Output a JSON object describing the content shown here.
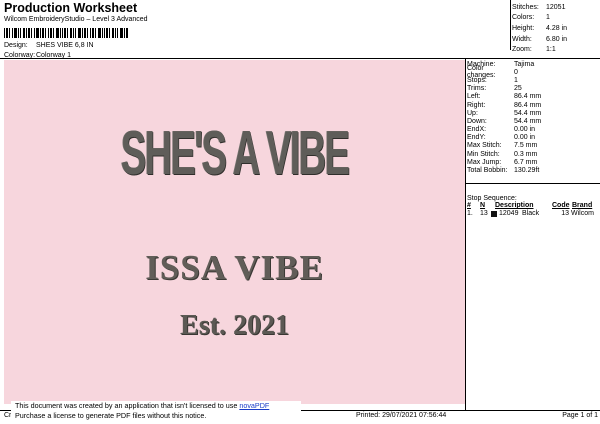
{
  "header": {
    "title": "Production Worksheet",
    "subtitle": "Wilcom EmbroideryStudio – Level 3 Advanced",
    "design_label": "Design:",
    "design_value": "SHES VIBE 6,8 IN",
    "colorway_label": "Colorway:",
    "colorway_value": "Colorway 1"
  },
  "stats": [
    {
      "label": "Stitches:",
      "value": "12051"
    },
    {
      "label": "Colors:",
      "value": "1"
    },
    {
      "label": "Height:",
      "value": "4.28 in"
    },
    {
      "label": "Width:",
      "value": "6.80 in"
    },
    {
      "label": "Zoom:",
      "value": "1:1"
    }
  ],
  "design_text": {
    "line1": "SHE'S A VIBE",
    "line2": "ISSA VIBE",
    "line3": "Est. 2021"
  },
  "machine_info": [
    {
      "label": "Machine:",
      "value": "Tajima"
    },
    {
      "label": "Color changes:",
      "value": "0"
    },
    {
      "label": "Stops:",
      "value": "1"
    },
    {
      "label": "Trims:",
      "value": "25"
    },
    {
      "label": "Left:",
      "value": "86.4 mm"
    },
    {
      "label": "Right:",
      "value": "86.4 mm"
    },
    {
      "label": "Up:",
      "value": "54.4 mm"
    },
    {
      "label": "Down:",
      "value": "54.4 mm"
    },
    {
      "label": "EndX:",
      "value": "0.00 in"
    },
    {
      "label": "EndY:",
      "value": "0.00 in"
    },
    {
      "label": "Max Stitch:",
      "value": "7.5 mm"
    },
    {
      "label": "Min Stitch:",
      "value": "0.3 mm"
    },
    {
      "label": "Max Jump:",
      "value": "6.7 mm"
    },
    {
      "label": "Total Bobbin:",
      "value": "130.29ft"
    }
  ],
  "stop_sequence": {
    "title": "Stop Sequence:",
    "headers": [
      "#",
      "N",
      "Description",
      "Code",
      "Brand"
    ],
    "rows": [
      {
        "num": "1.",
        "n": "13",
        "code_id": "12049",
        "description": "Black",
        "code": "13",
        "brand": "Wilcom"
      }
    ]
  },
  "footer": {
    "left": "Cr",
    "printed": "Printed: 29/07/2021 07:56:44",
    "page": "Page 1 of 1"
  },
  "notice": {
    "line1": "This document was created by an application that isn't licensed to use",
    "link": "novaPDF",
    "line2": "Purchase a license to generate PDF files without this notice."
  },
  "colors": {
    "design_background": "#f7d6dd",
    "thread": "#5f5d59"
  }
}
